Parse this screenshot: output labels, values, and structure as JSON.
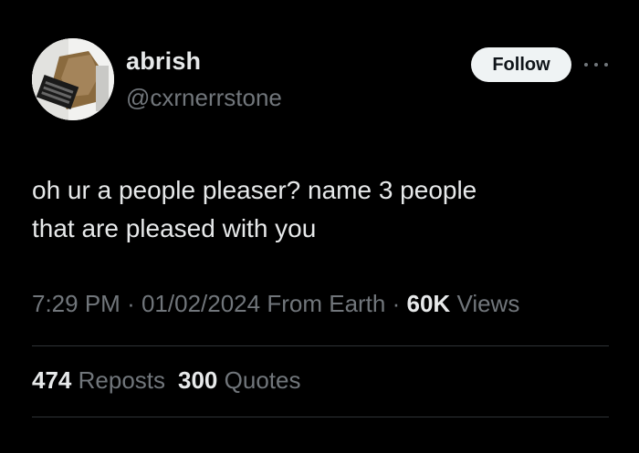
{
  "user": {
    "display_name": "abrish",
    "handle": "@cxrnerrstone",
    "avatar_icon": "avatar-photo"
  },
  "follow_label": "Follow",
  "more_icon": "more-horizontal-icon",
  "tweet": {
    "lines": [
      "oh ur a people pleaser? name 3 people",
      "that are pleased with you"
    ]
  },
  "meta": {
    "time": "7:29 PM",
    "separator": "·",
    "date": "01/02/2024",
    "source": "From Earth",
    "views_count": "60K",
    "views_label": "Views"
  },
  "stats": {
    "reposts_count": "474",
    "reposts_label": "Reposts",
    "quotes_count": "300",
    "quotes_label": "Quotes"
  },
  "colors": {
    "background": "#000000",
    "primary_text": "#e7e9ea",
    "secondary_text": "#71767b",
    "follow_button_bg": "#eff3f4",
    "divider": "#2f3336"
  }
}
